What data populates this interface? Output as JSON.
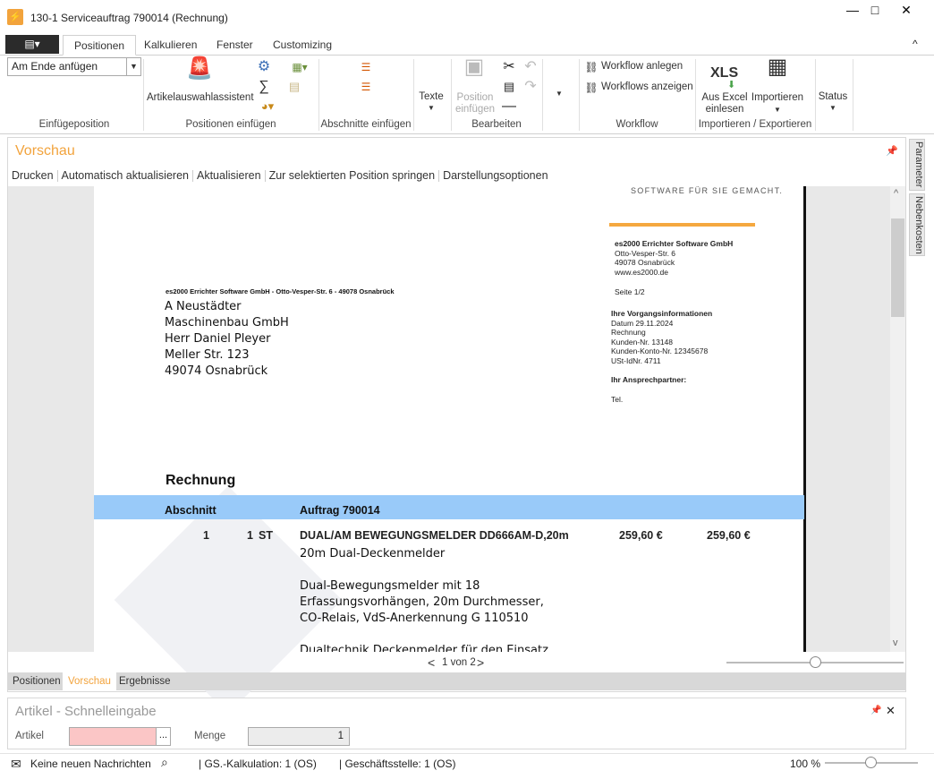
{
  "window": {
    "title": "130-1 Serviceauftrag 790014 (Rechnung)",
    "minimize": "—",
    "maximize": "□",
    "close": "✕"
  },
  "ribbon": {
    "file_menu": "▤▾",
    "tabs": [
      "Positionen",
      "Kalkulieren",
      "Fenster",
      "Customizing"
    ],
    "collapse": "^",
    "insert_position": {
      "value": "Am Ende anfügen",
      "label": "Einfügeposition"
    },
    "positions_group": {
      "wizard": "Artikelauswahlassistent",
      "label": "Positionen einfügen"
    },
    "sections_group": {
      "label": "Abschnitte einfügen"
    },
    "texts": "Texte",
    "edit_group": {
      "insert_position": "Position einfügen",
      "label": "Bearbeiten"
    },
    "workflow_group": {
      "create": "Workflow anlegen",
      "show": "Workflows anzeigen",
      "label": "Workflow"
    },
    "import_group": {
      "excel_icon": "XLS",
      "excel": "Aus Excel einlesen",
      "import": "Importieren",
      "label": "Importieren / Exportieren"
    },
    "status": "Status"
  },
  "preview": {
    "title": "Vorschau",
    "toolbar": [
      "Drucken",
      "Automatisch aktualisieren",
      "Aktualisieren",
      "Zur selektierten Position springen",
      "Darstellungsoptionen"
    ],
    "pager": "1 von 2",
    "side_tabs": [
      "Parameter",
      "Nebenkosten"
    ]
  },
  "document": {
    "slogan": "SOFTWARE FÜR SIE GEMACHT.",
    "company_block": [
      "es2000 Errichter Software GmbH",
      "Otto-Vesper-Str. 6",
      "49078 Osnabrück",
      "www.es2000.de"
    ],
    "page": "Seite 1/2",
    "sender_line": "es2000 Errichter Software GmbH - Otto-Vesper-Str. 6 - 49078 Osnabrück",
    "recipient": [
      "A Neustädter",
      "Maschinenbau GmbH",
      "Herr Daniel Pleyer",
      "Meller Str. 123",
      "49074 Osnabrück"
    ],
    "info_title": "Ihre Vorgangsinformationen",
    "info_lines": [
      "Datum 29.11.2024",
      "Rechnung",
      "Kunden-Nr. 13148",
      "Kunden-Konto-Nr. 12345678",
      "USt-IdNr. 4711"
    ],
    "contact_title": "Ihr Ansprechpartner:",
    "tel": "Tel.",
    "doc_title": "Rechnung",
    "section_col": "Abschnitt",
    "order": "Auftrag 790014",
    "item": {
      "pos": "1",
      "qty": "1",
      "unit": "ST",
      "name": "DUAL/AM BEWEGUNGSMELDER DD666AM-D,20m",
      "price": "259,60 €",
      "total": "259,60 €",
      "desc1": "20m Dual-Deckenmelder",
      "desc2": [
        "Dual-Bewegungsmelder mit 18",
        "Erfassungsvorhängen, 20m Durchmesser,",
        "CO-Relais, VdS-Anerkennung G 110510"
      ],
      "desc3": "Dualtechnik Deckenmelder für den Einsatz"
    }
  },
  "bottom_tabs": [
    "Positionen",
    "Vorschau",
    "Ergebnisse"
  ],
  "quick_entry": {
    "title": "Artikel - Schnelleingabe",
    "article_label": "Artikel",
    "article_value": "",
    "browse": "...",
    "qty_label": "Menge",
    "qty_value": "1"
  },
  "statusbar": {
    "messages": "Keine neuen Nachrichten",
    "calc": "| GS.-Kalkulation:  1 (OS)",
    "branch": "| Geschäftsstelle:  1 (OS)",
    "zoom": "100 %"
  }
}
